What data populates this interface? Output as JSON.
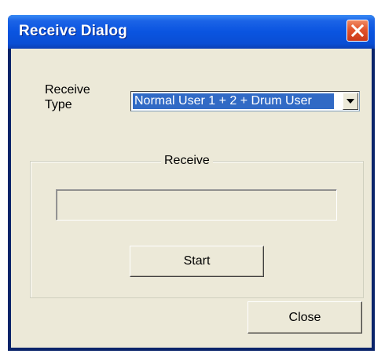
{
  "window": {
    "title": "Receive Dialog"
  },
  "receive_type": {
    "label": "Receive\nType",
    "selected_value": "Normal User 1 + 2 + Drum User"
  },
  "group": {
    "title": "Receive"
  },
  "progress": {
    "value": 0
  },
  "buttons": {
    "start_label": "Start",
    "close_label": "Close"
  },
  "icons": {
    "title_close": "close-x-icon",
    "dropdown": "chevron-down-icon"
  },
  "colors": {
    "title_bar": "#0a54e0",
    "close_button": "#e2542c",
    "dialog_face": "#ece9d8",
    "selection": "#316ac5"
  }
}
